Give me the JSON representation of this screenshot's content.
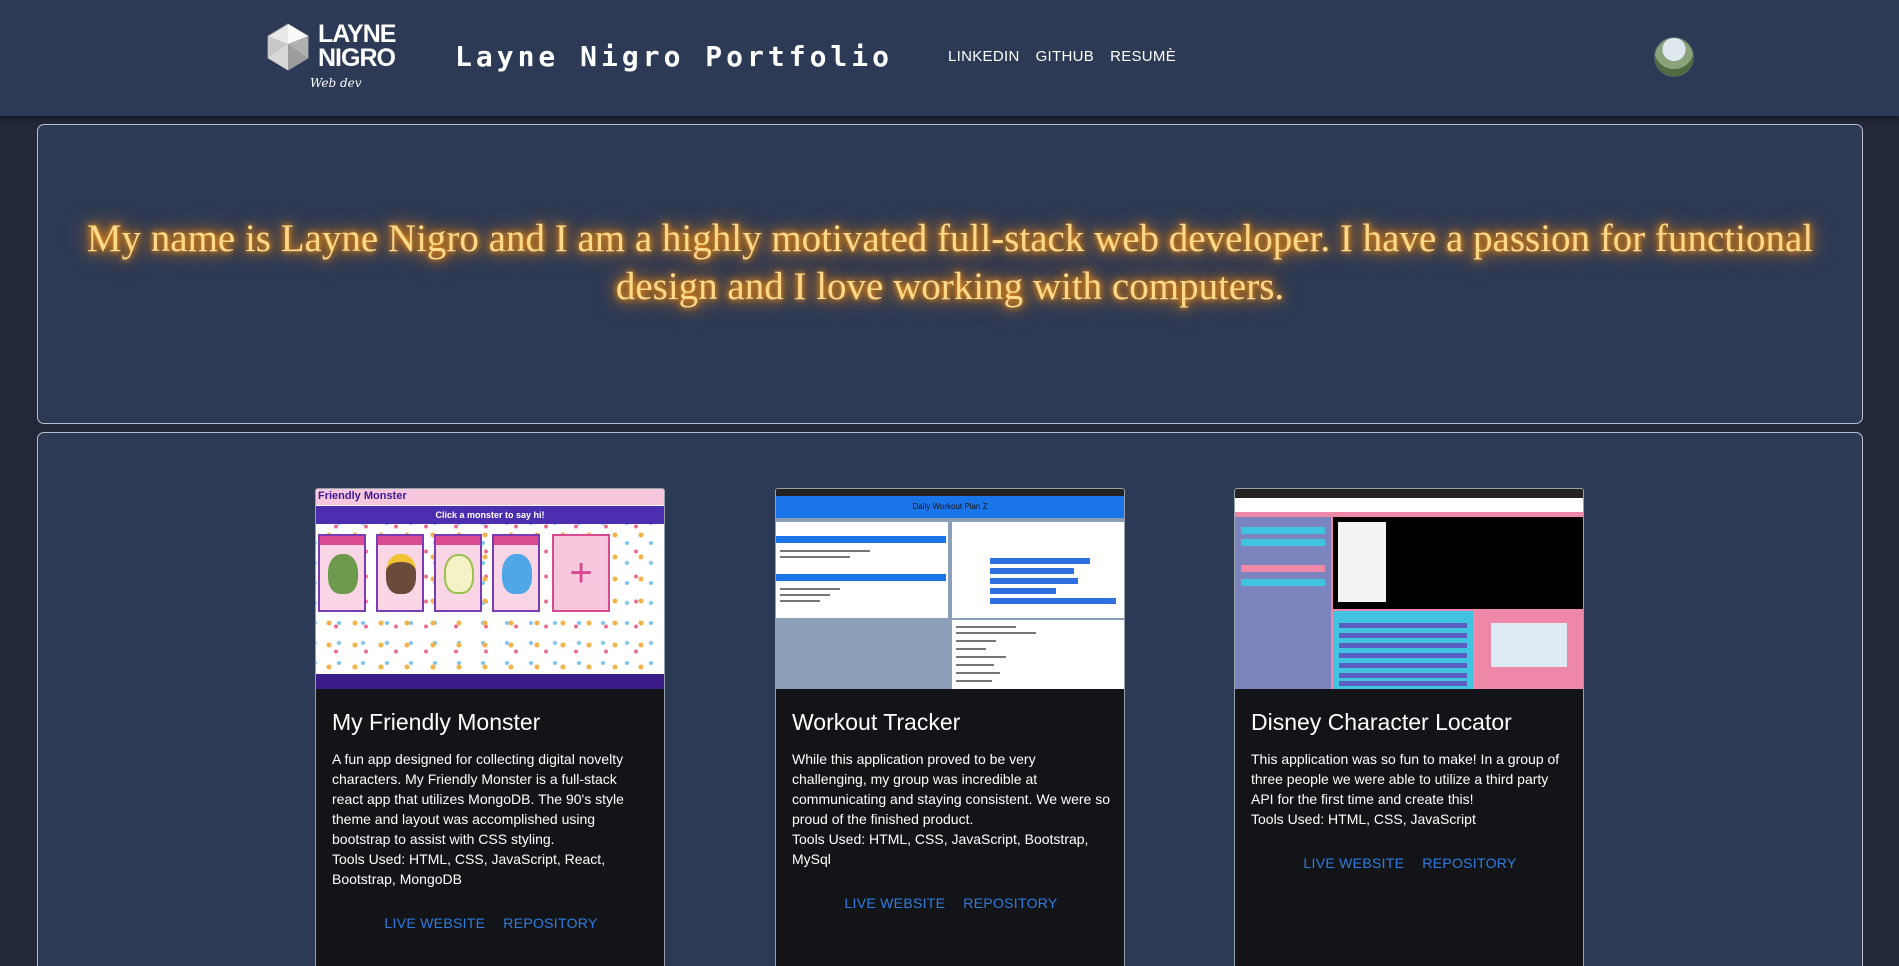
{
  "header": {
    "logo": {
      "line1": "LAYNE",
      "line2": "NIGRO",
      "tagline": "Web dev"
    },
    "title": "Layne Nigro Portfolio",
    "nav": [
      "LINKEDIN",
      "GITHUB",
      "RESUMÈ"
    ]
  },
  "hero": {
    "text": "My name is Layne Nigro and I am a highly motivated full-stack web developer. I have a passion for functional design and I love working with computers."
  },
  "projects": [
    {
      "title": "My Friendly Monster",
      "description": "A fun app designed for collecting digital novelty characters. My Friendly Monster is a full-stack react app that utilizes MongoDB. The 90's style theme and layout was accomplished using bootstrap to assist with CSS styling.",
      "tools": "Tools Used: HTML, CSS, JavaScript, React, Bootstrap, MongoDB",
      "live_label": "LIVE WEBSITE",
      "repo_label": "REPOSITORY",
      "thumb_title": "Friendly Monster",
      "thumb_sub": "Click a monster to say hi!"
    },
    {
      "title": "Workout Tracker",
      "description": "While this application proved to be very challenging, my group was incredible at communicating and staying consistent. We were so proud of the finished product.",
      "tools": "Tools Used: HTML, CSS, JavaScript, Bootstrap, MySql",
      "live_label": "LIVE WEBSITE",
      "repo_label": "REPOSITORY",
      "thumb_title": "Daily Workout Plan Z"
    },
    {
      "title": "Disney Character Locator",
      "description": "This application was so fun to make! In a group of three people we were able to utilize a third party API for the first time and create this!",
      "tools": "Tools Used: HTML, CSS, JavaScript",
      "live_label": "LIVE WEBSITE",
      "repo_label": "REPOSITORY"
    }
  ],
  "colors": {
    "header_bg": "#2d3a55",
    "page_bg": "#23293a",
    "hero_glow": "#ff8a00",
    "link": "#2f7de0",
    "card_bg": "#121418"
  }
}
